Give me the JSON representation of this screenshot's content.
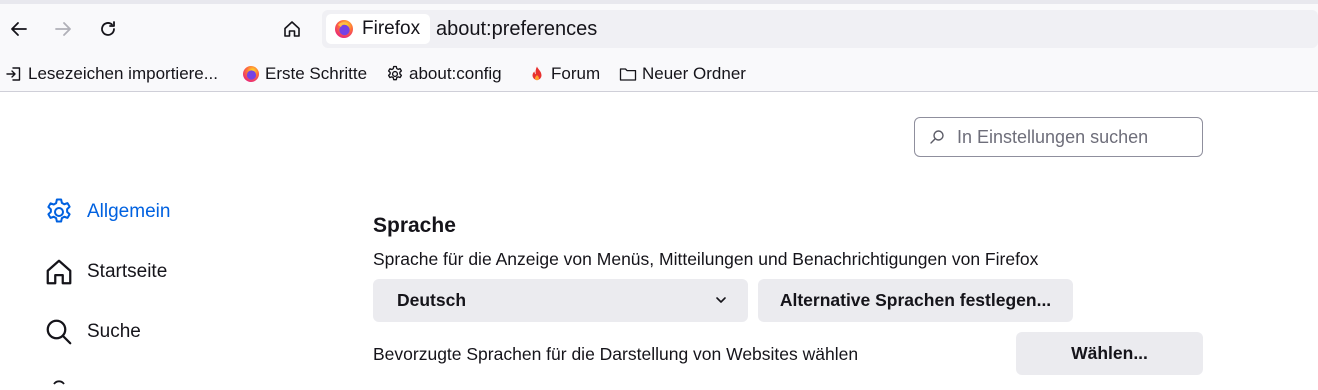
{
  "browser": {
    "identity_label": "Firefox",
    "url": "about:preferences",
    "brand_color": "#ff7139"
  },
  "bookmarks": [
    {
      "label": "Lesezeichen importiere...",
      "icon": "import-icon"
    },
    {
      "label": "Erste Schritte",
      "icon": "firefox-logo-icon"
    },
    {
      "label": "about:config",
      "icon": "gear-icon"
    },
    {
      "label": "Forum",
      "icon": "flame-icon"
    },
    {
      "label": "Neuer Ordner",
      "icon": "folder-icon"
    }
  ],
  "search": {
    "placeholder": "In Einstellungen suchen"
  },
  "categories": [
    {
      "label": "Allgemein",
      "icon": "gear-icon",
      "selected": true
    },
    {
      "label": "Startseite",
      "icon": "home-icon",
      "selected": false
    },
    {
      "label": "Suche",
      "icon": "search-icon",
      "selected": false
    }
  ],
  "language_section": {
    "title": "Sprache",
    "description": "Sprache für die Anzeige von Menüs, Mitteilungen und Benachrichtigungen von Firefox",
    "selected_language": "Deutsch",
    "alt_languages_button": "Alternative Sprachen festlegen...",
    "website_languages_description": "Bevorzugte Sprachen für die Darstellung von Websites wählen",
    "choose_button": "Wählen..."
  },
  "colors": {
    "accent": "#0061e0",
    "button_bg": "#ebebef"
  }
}
